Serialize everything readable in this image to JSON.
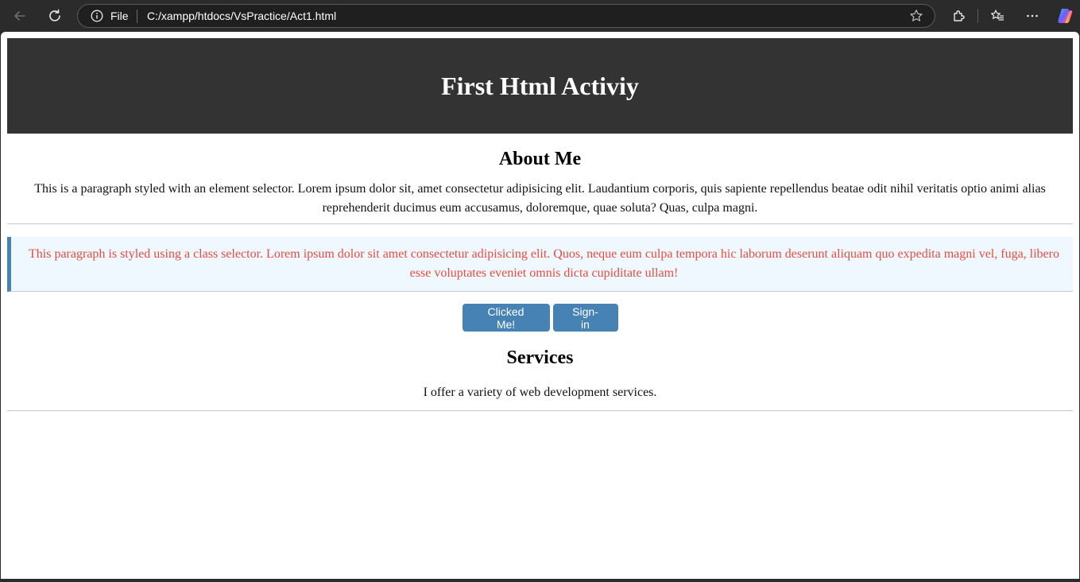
{
  "browser": {
    "address_scheme": "File",
    "address_url": "C:/xampp/htdocs/VsPractice/Act1.html",
    "icons": {
      "back": "back-arrow-icon",
      "refresh": "refresh-icon",
      "info": "info-icon",
      "favorite": "star-icon",
      "extensions": "extensions-icon",
      "favorites": "favorites-icon",
      "more": "more-icon",
      "copilot": "copilot-icon"
    }
  },
  "page": {
    "header_title": "First Html Activiy",
    "about": {
      "heading": "About Me",
      "text": "This is a paragraph styled with an element selector. Lorem ipsum dolor sit, amet consectetur adipisicing elit. Laudantium corporis, quis sapiente repellendus beatae odit nihil veritatis optio animi alias reprehenderit ducimus eum accusamus, doloremque, quae soluta? Quas, culpa magni."
    },
    "highlight_text": "This paragraph is styled using a class selector. Lorem ipsum dolor sit amet consectetur adipisicing elit. Quos, neque eum culpa tempora hic laborum deserunt aliquam quo expedita magni vel, fuga, libero esse voluptates eveniet omnis dicta cupiditate ullam!",
    "buttons": {
      "clicked_label": "Clicked Me!",
      "signin_label": "Sign-in"
    },
    "services": {
      "heading": "Services",
      "text": "I offer a variety of web development services."
    }
  },
  "colors": {
    "header_bg": "#333333",
    "button_bg": "#4682b4",
    "highlight_bg": "#f0f8ff",
    "highlight_border": "#4682b4",
    "highlight_text": "#e74c3c"
  }
}
